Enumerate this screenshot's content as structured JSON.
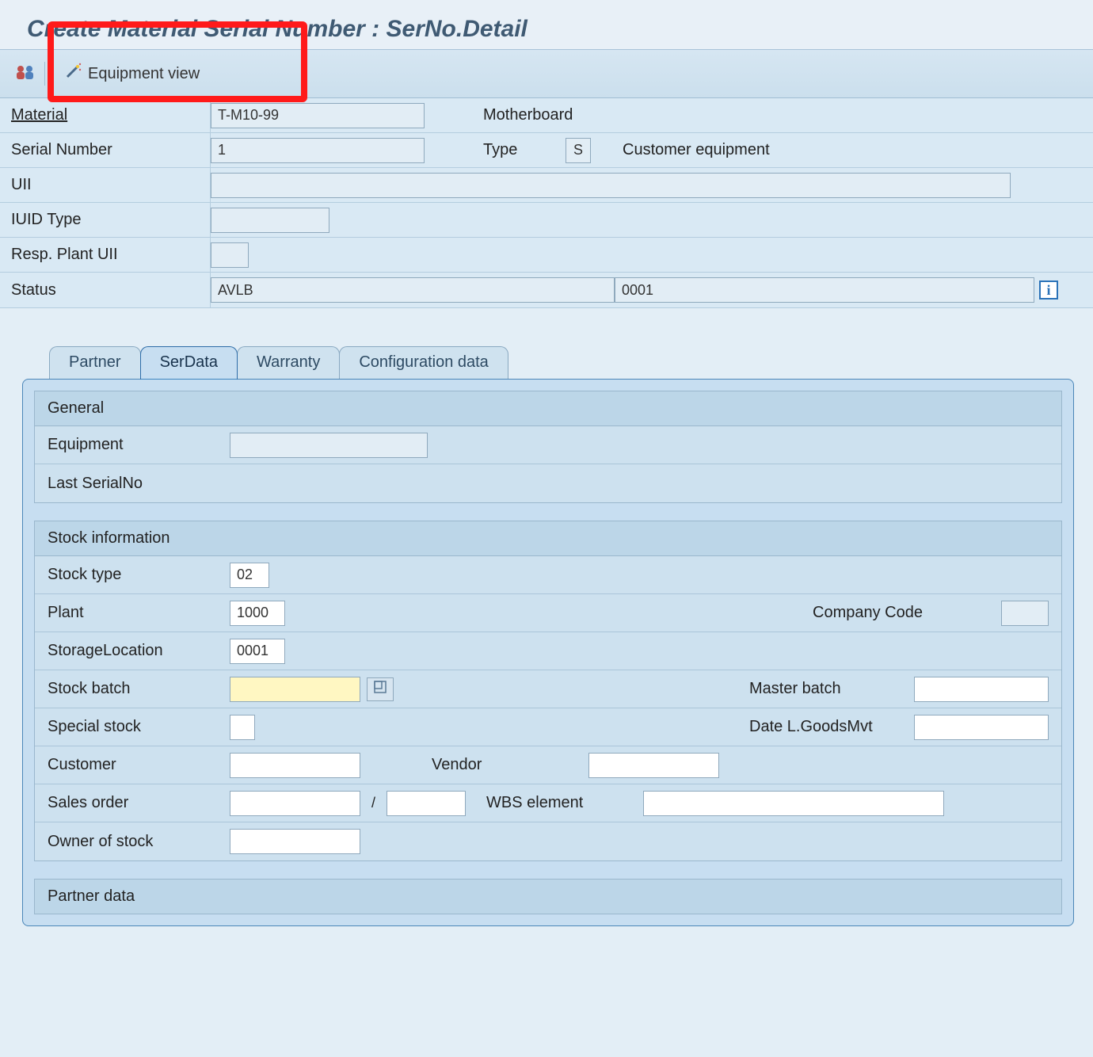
{
  "page_title": "Create Material Serial Number : SerNo.Detail",
  "toolbar": {
    "equipment_view_label": "Equipment view"
  },
  "header": {
    "material_label": "Material",
    "material_value": "T-M10-99",
    "material_desc": "Motherboard",
    "serial_label": "Serial Number",
    "serial_value": "1",
    "type_label": "Type",
    "type_value": "S",
    "type_desc": "Customer equipment",
    "uii_label": "UII",
    "uii_value": "",
    "iuid_type_label": "IUID Type",
    "iuid_type_value": "",
    "resp_plant_uii_label": "Resp. Plant UII",
    "resp_plant_uii_value": "",
    "status_label": "Status",
    "status_value": "AVLB",
    "status_num": "0001"
  },
  "tabs": {
    "partner": "Partner",
    "serdata": "SerData",
    "warranty": "Warranty",
    "configdata": "Configuration data",
    "active": "serdata"
  },
  "serdata": {
    "general": {
      "title": "General",
      "equipment_label": "Equipment",
      "equipment_value": "",
      "last_serial_label": "Last SerialNo",
      "last_serial_value": ""
    },
    "stock": {
      "title": "Stock information",
      "stock_type_label": "Stock type",
      "stock_type_value": "02",
      "plant_label": "Plant",
      "plant_value": "1000",
      "company_code_label": "Company Code",
      "company_code_value": "",
      "storage_loc_label": "StorageLocation",
      "storage_loc_value": "0001",
      "stock_batch_label": "Stock batch",
      "stock_batch_value": "",
      "master_batch_label": "Master batch",
      "master_batch_value": "",
      "special_stock_label": "Special stock",
      "special_stock_value": "",
      "date_lgoodsmvt_label": "Date L.GoodsMvt",
      "date_lgoodsmvt_value": "",
      "customer_label": "Customer",
      "customer_value": "",
      "vendor_label": "Vendor",
      "vendor_value": "",
      "sales_order_label": "Sales order",
      "sales_order_value": "",
      "sales_order_sep": "/",
      "sales_order_item_value": "",
      "wbs_label": "WBS element",
      "wbs_value": "",
      "owner_label": "Owner of stock",
      "owner_value": ""
    },
    "partner_data": {
      "title": "Partner data"
    }
  }
}
